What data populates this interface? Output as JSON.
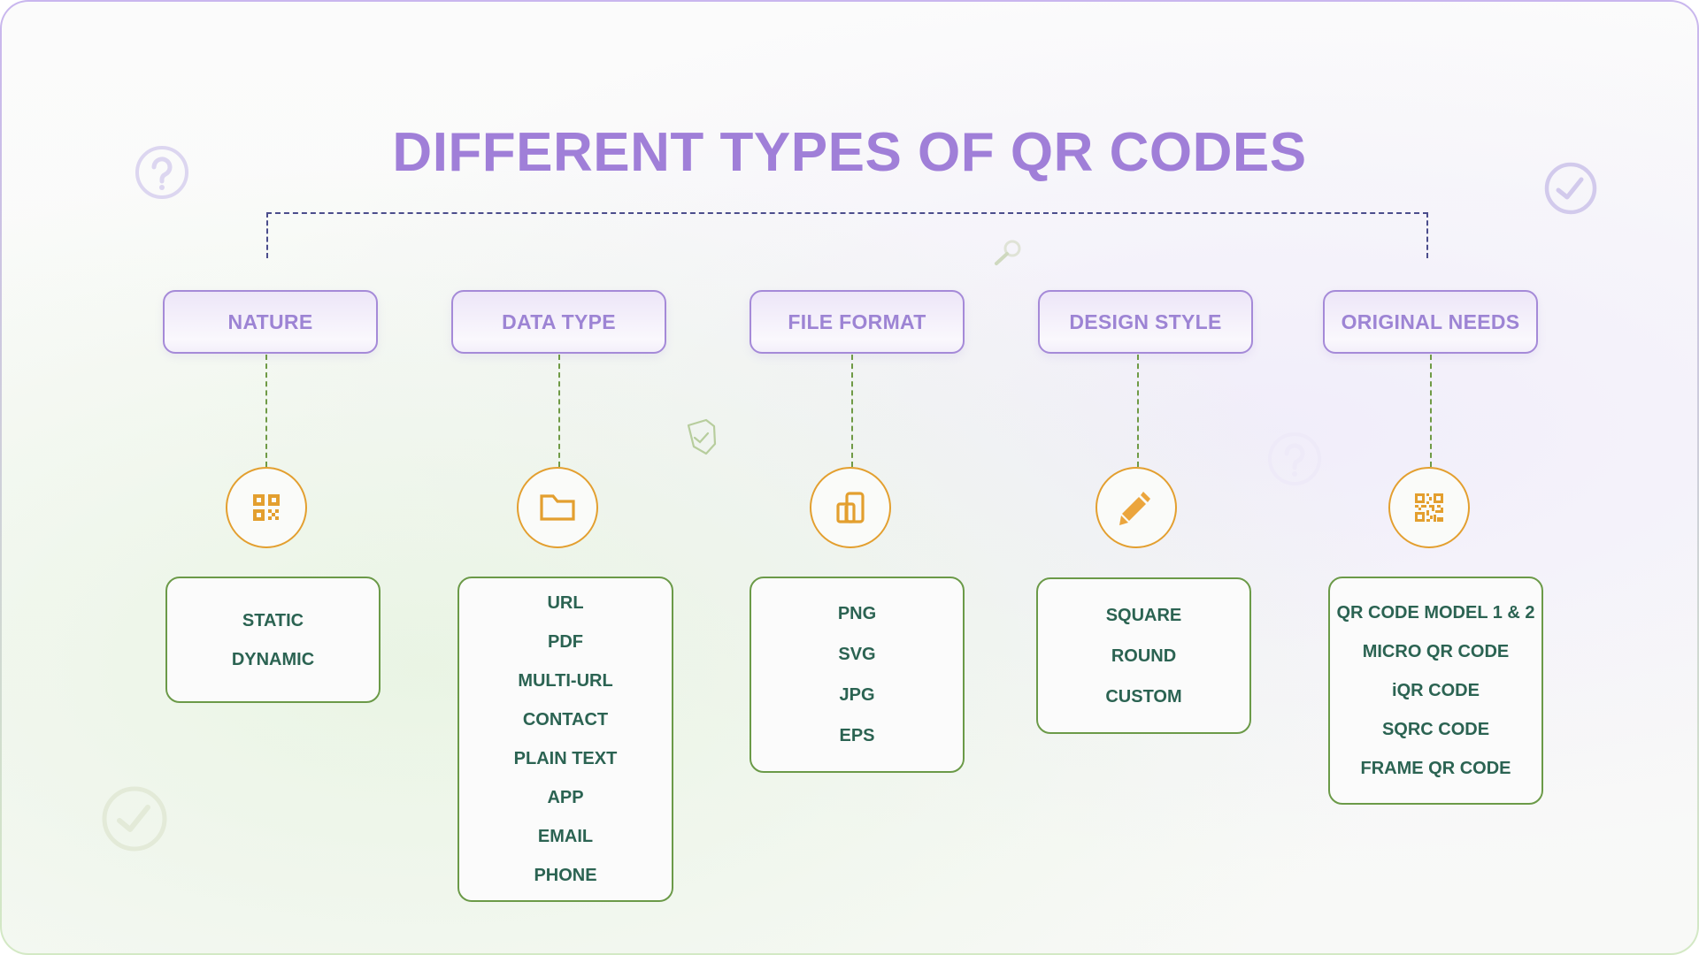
{
  "title": "DIFFERENT TYPES OF QR CODES",
  "colors": {
    "title": "#a07fd8",
    "header_border": "#a58ad8",
    "header_text": "#9d84d4",
    "icon_orange": "#e39f2f",
    "box_border": "#6b9a48",
    "box_text": "#2b6352",
    "bracket": "#4b4d8c"
  },
  "categories": [
    {
      "label": "NATURE",
      "icon": "qr-grid-icon",
      "items": [
        "STATIC",
        "DYNAMIC"
      ]
    },
    {
      "label": "DATA TYPE",
      "icon": "folder-icon",
      "items": [
        "URL",
        "PDF",
        "MULTI-URL",
        "CONTACT",
        "PLAIN TEXT",
        "APP",
        "EMAIL",
        "PHONE"
      ]
    },
    {
      "label": "FILE FORMAT",
      "icon": "file-chart-icon",
      "items": [
        "PNG",
        "SVG",
        "JPG",
        "EPS"
      ]
    },
    {
      "label": "DESIGN STYLE",
      "icon": "pencil-icon",
      "items": [
        "SQUARE",
        "ROUND",
        "CUSTOM"
      ]
    },
    {
      "label": "ORIGINAL NEEDS",
      "icon": "qr-code-icon",
      "items": [
        "QR CODE MODEL 1 & 2",
        "MICRO QR CODE",
        "iQR CODE",
        "SQRC CODE",
        "FRAME QR CODE"
      ]
    }
  ],
  "decorations": [
    "question-circle-icon",
    "check-circle-icon",
    "magnifier-icon",
    "shield-check-icon",
    "question-circle-icon",
    "check-circle-icon"
  ]
}
